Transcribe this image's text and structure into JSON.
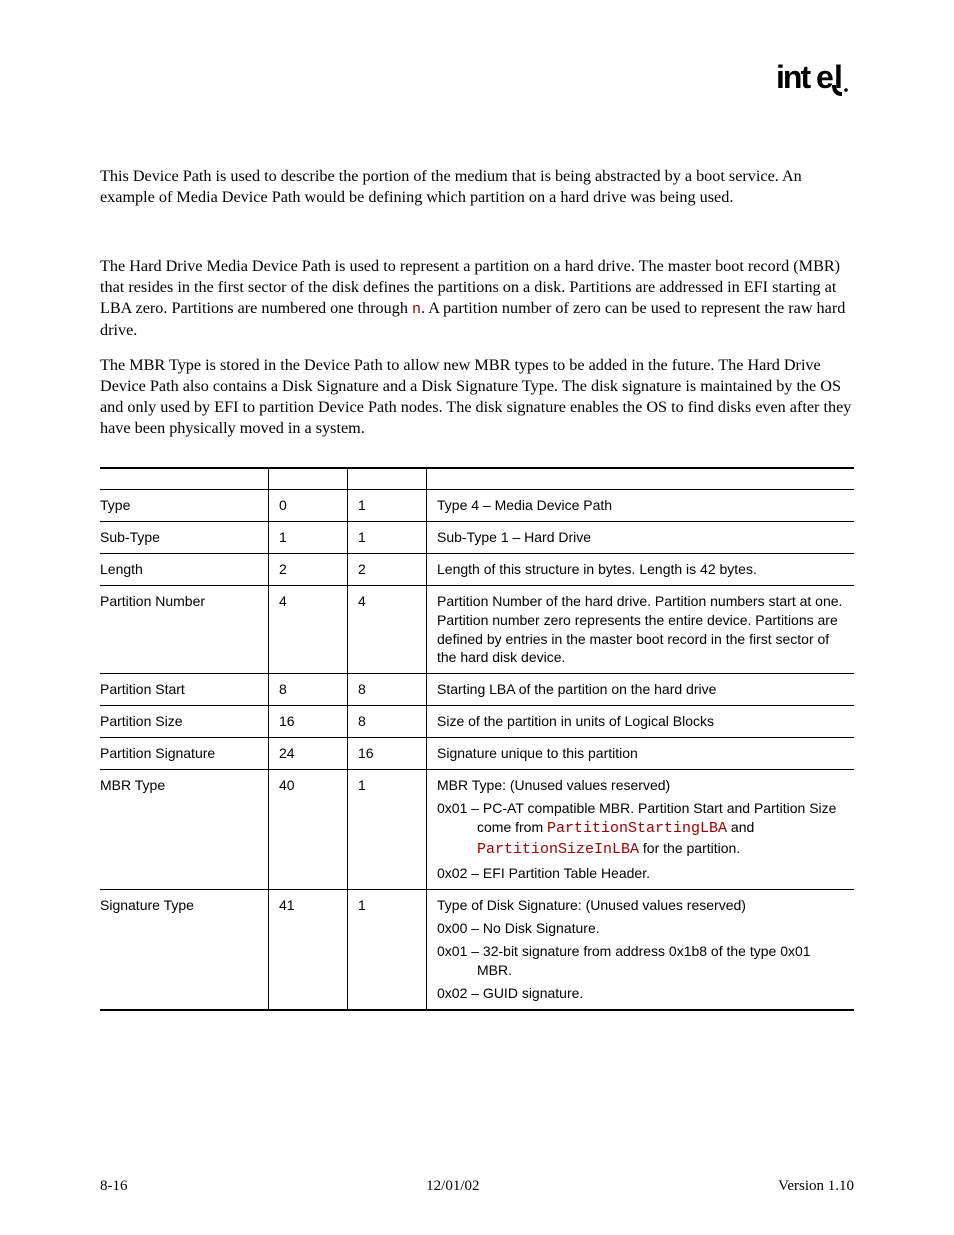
{
  "logo_text": "intel",
  "paragraphs": {
    "p1": "This Device Path is used to describe the portion of the medium that is being abstracted by a boot service.  An example of Media Device Path would be defining which partition on a hard drive was being used.",
    "p2a": "The Hard Drive Media Device Path is used to represent a partition on a hard drive.  The master boot record (MBR) that resides in the first sector of the disk defines the partitions on a disk.  Partitions are addressed in EFI starting at LBA zero.  Partitions are numbered one through ",
    "p2_code": "n",
    "p2b": ".  A partition number of zero can be used to represent the raw hard drive.",
    "p3": "The MBR Type is stored in the Device Path to allow new MBR types to be added in the future.  The Hard Drive Device Path also contains a Disk Signature and a Disk Signature Type.  The disk signature is maintained by the OS and only used by EFI to partition Device Path nodes.  The disk signature enables the OS to find disks even after they have been physically moved in a system."
  },
  "table": {
    "headers": {
      "mnemonic": "",
      "byte_offset": "",
      "byte_length": "",
      "description": ""
    },
    "rows": [
      {
        "m": "Type",
        "b": "0",
        "l": "1",
        "d": "Type 4 – Media Device Path"
      },
      {
        "m": "Sub-Type",
        "b": "1",
        "l": "1",
        "d": "Sub-Type 1 – Hard Drive"
      },
      {
        "m": "Length",
        "b": "2",
        "l": "2",
        "d": "Length of this structure in bytes.  Length is 42 bytes."
      },
      {
        "m": "Partition Number",
        "b": "4",
        "l": "4",
        "d": "Partition Number of the hard drive.  Partition numbers start at one.  Partition number zero represents the entire device.  Partitions are defined by entries in the master boot record in the first sector of the hard disk device."
      },
      {
        "m": "Partition Start",
        "b": "8",
        "l": "8",
        "d": "Starting LBA of the partition on the hard drive"
      },
      {
        "m": "Partition Size",
        "b": "16",
        "l": "8",
        "d": "Size of the partition in units of Logical Blocks"
      },
      {
        "m": "Partition Signature",
        "b": "24",
        "l": "16",
        "d": "Signature unique to this partition"
      }
    ],
    "mbr_row": {
      "m": "MBR Type",
      "b": "40",
      "l": "1",
      "d1": "MBR Type:  (Unused values reserved)",
      "d2a": "0x01 – PC-AT compatible MBR.  Partition Start and Partition Size come from ",
      "d2_code1": "PartitionStartingLBA",
      "d2_mid": " and ",
      "d2_code2": "PartitionSizeInLBA",
      "d2b": " for the partition.",
      "d3": "0x02 – EFI Partition Table Header."
    },
    "sig_row": {
      "m": "Signature Type",
      "b": "41",
      "l": "1",
      "d1": "Type of Disk Signature:  (Unused values reserved)",
      "d2": "0x00 – No Disk Signature.",
      "d3": "0x01 – 32-bit signature from address 0x1b8 of the type 0x01 MBR.",
      "d4": "0x02 – GUID signature."
    }
  },
  "footer": {
    "left": "8-16",
    "center": "12/01/02",
    "right": "Version 1.10"
  }
}
